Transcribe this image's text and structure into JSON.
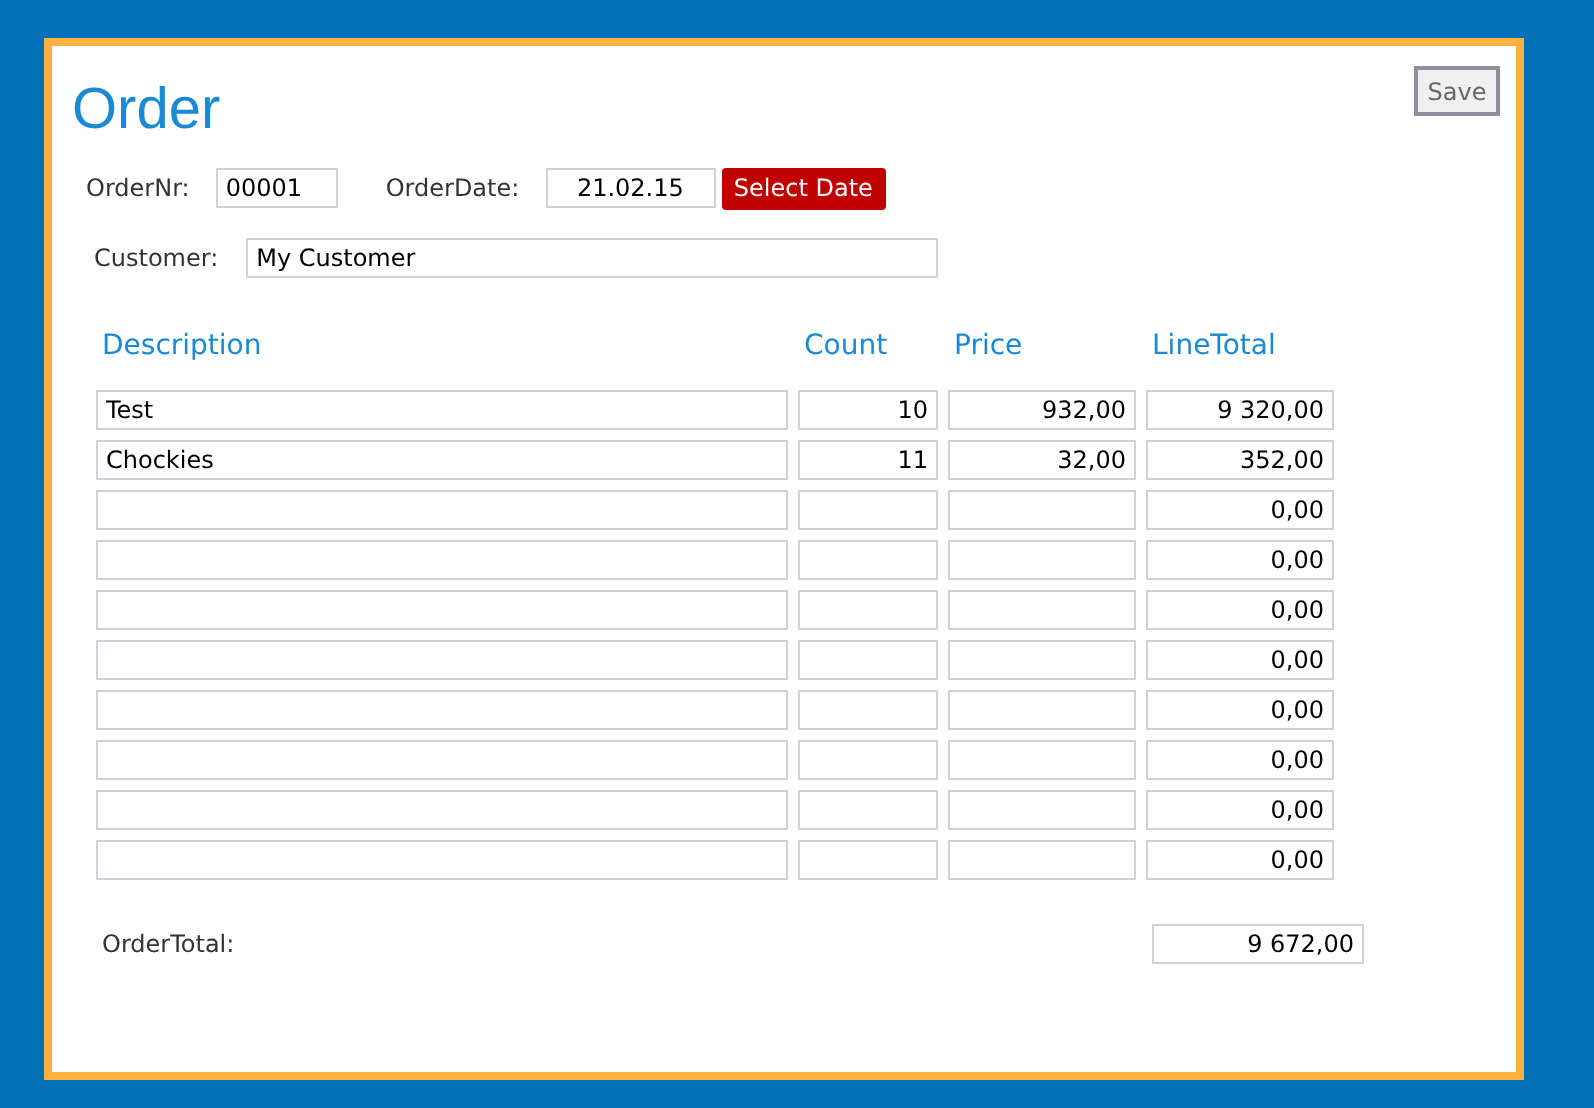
{
  "title": "Order",
  "save_button": "Save",
  "order_nr": {
    "label": "OrderNr:",
    "value": "00001"
  },
  "order_date": {
    "label": "OrderDate:",
    "value": "21.02.15"
  },
  "select_date_button": "Select Date",
  "customer": {
    "label": "Customer:",
    "value": "My Customer"
  },
  "table": {
    "columns": [
      "Description",
      "Count",
      "Price",
      "LineTotal"
    ],
    "rows": [
      {
        "description": "Test",
        "count": "10",
        "price": "932,00",
        "line_total": "9 320,00"
      },
      {
        "description": "Chockies",
        "count": "11",
        "price": "32,00",
        "line_total": "352,00"
      },
      {
        "line_total": "0,00"
      },
      {
        "line_total": "0,00"
      },
      {
        "line_total": "0,00"
      },
      {
        "line_total": "0,00"
      },
      {
        "line_total": "0,00"
      },
      {
        "line_total": "0,00"
      },
      {
        "line_total": "0,00"
      },
      {
        "line_total": "0,00"
      }
    ]
  },
  "order_total": {
    "label": "OrderTotal:",
    "value": "9 672,00"
  }
}
